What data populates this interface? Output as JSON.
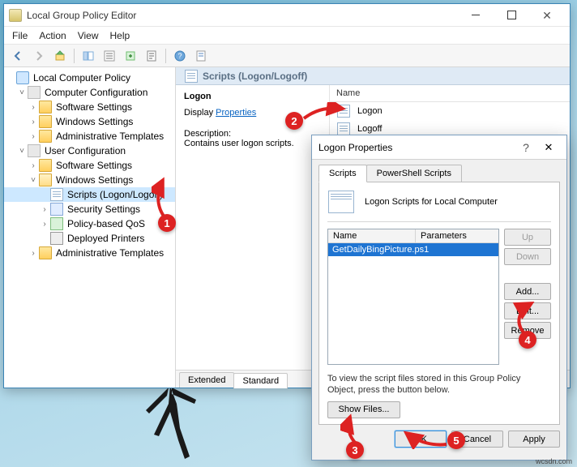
{
  "gpedit": {
    "title": "Local Group Policy Editor",
    "menu": {
      "file": "File",
      "action": "Action",
      "view": "View",
      "help": "Help"
    },
    "tree": {
      "root": "Local Computer Policy",
      "comp": "Computer Configuration",
      "comp_sw": "Software Settings",
      "comp_win": "Windows Settings",
      "comp_adm": "Administrative Templates",
      "user": "User Configuration",
      "user_sw": "Software Settings",
      "user_win": "Windows Settings",
      "user_scripts": "Scripts (Logon/Logoff)",
      "user_sec": "Security Settings",
      "user_qos": "Policy-based QoS",
      "user_printers": "Deployed Printers",
      "user_adm": "Administrative Templates"
    },
    "right": {
      "header": "Scripts (Logon/Logoff)",
      "section_title": "Logon",
      "display_label": "Display",
      "properties_link": "Properties ",
      "desc_label": "Description:",
      "desc_text": "Contains user logon scripts.",
      "col_name": "Name",
      "items": {
        "logon": "Logon",
        "logoff": "Logoff"
      },
      "tabs": {
        "extended": "Extended",
        "standard": "Standard"
      }
    }
  },
  "dialog": {
    "title": "Logon Properties",
    "tabs": {
      "scripts": "Scripts",
      "ps": "PowerShell Scripts"
    },
    "heading": "Logon Scripts for Local Computer",
    "list": {
      "col_name": "Name",
      "col_params": "Parameters",
      "rows": [
        {
          "name": "GetDailyBingPicture.ps1",
          "params": ""
        }
      ]
    },
    "buttons": {
      "up": "Up",
      "down": "Down",
      "add": "Add...",
      "edit": "Edit...",
      "remove": "Remove",
      "show_files": "Show Files...",
      "ok": "OK",
      "cancel": "Cancel",
      "apply": "Apply"
    },
    "note": "To view the script files stored in this Group Policy Object, press the button below."
  },
  "callouts": {
    "c1": "1",
    "c2": "2",
    "c3": "3",
    "c4": "4",
    "c5": "5"
  },
  "watermark": "wcsdn.com"
}
